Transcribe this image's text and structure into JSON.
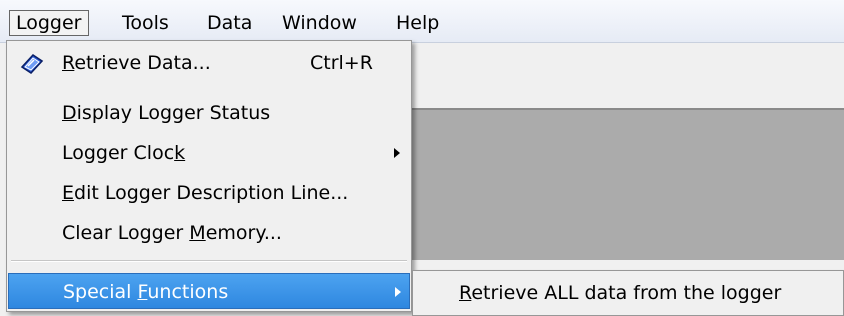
{
  "menubar": {
    "items": [
      {
        "label": "Logger"
      },
      {
        "label": "Tools"
      },
      {
        "label": "Data"
      },
      {
        "label": "Window"
      },
      {
        "label": "Help"
      }
    ]
  },
  "logger_menu": {
    "items": [
      {
        "pre": "",
        "mnemonic": "R",
        "post": "etrieve Data...",
        "shortcut": "Ctrl+R",
        "icon": "retrieve-data-icon"
      },
      {
        "pre": "",
        "mnemonic": "D",
        "post": "isplay Logger Status"
      },
      {
        "pre": "Logger Cloc",
        "mnemonic": "k",
        "post": "",
        "submenu": true
      },
      {
        "pre": "",
        "mnemonic": "E",
        "post": "dit Logger Description Line..."
      },
      {
        "pre": "Clear Logger ",
        "mnemonic": "M",
        "post": "emory..."
      },
      {
        "pre": "Special ",
        "mnemonic": "F",
        "post": "unctions",
        "submenu": true,
        "highlighted": true
      }
    ]
  },
  "special_functions_submenu": {
    "items": [
      {
        "pre": "",
        "mnemonic": "R",
        "post": "etrieve ALL data from the logger"
      }
    ]
  },
  "colors": {
    "highlight": "#3a92e6",
    "content_area": "#ababab"
  }
}
